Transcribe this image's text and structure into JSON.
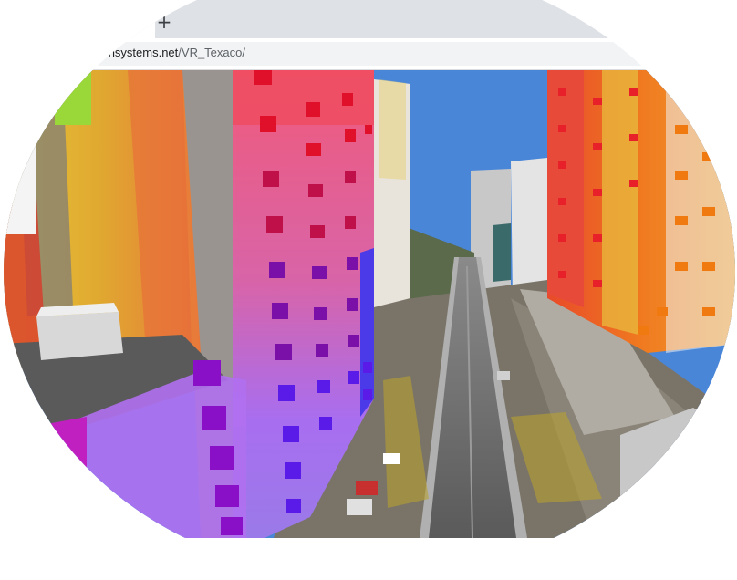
{
  "browser": {
    "tab": {
      "close_glyph": "×"
    },
    "new_tab_glyph": "+",
    "address": {
      "url_host": "iz.odensystems.net",
      "url_path": "/VR_Texaco/"
    },
    "extension_glyph": "⋮"
  },
  "scene": {
    "description_icon": "3d-city-model-icon",
    "colors": {
      "sky": "#4a86d8",
      "road": "#6e6e6e",
      "building_pink": "#e85a8a",
      "building_purple": "#a86ef0",
      "building_red": "#e83a2a",
      "building_orange": "#f08a1a",
      "building_yellow": "#d8d83a",
      "building_grey": "#b8b8b8",
      "marker_red": "#e0102a",
      "marker_purple": "#7a10c8",
      "marker_magenta": "#c010c8"
    }
  }
}
